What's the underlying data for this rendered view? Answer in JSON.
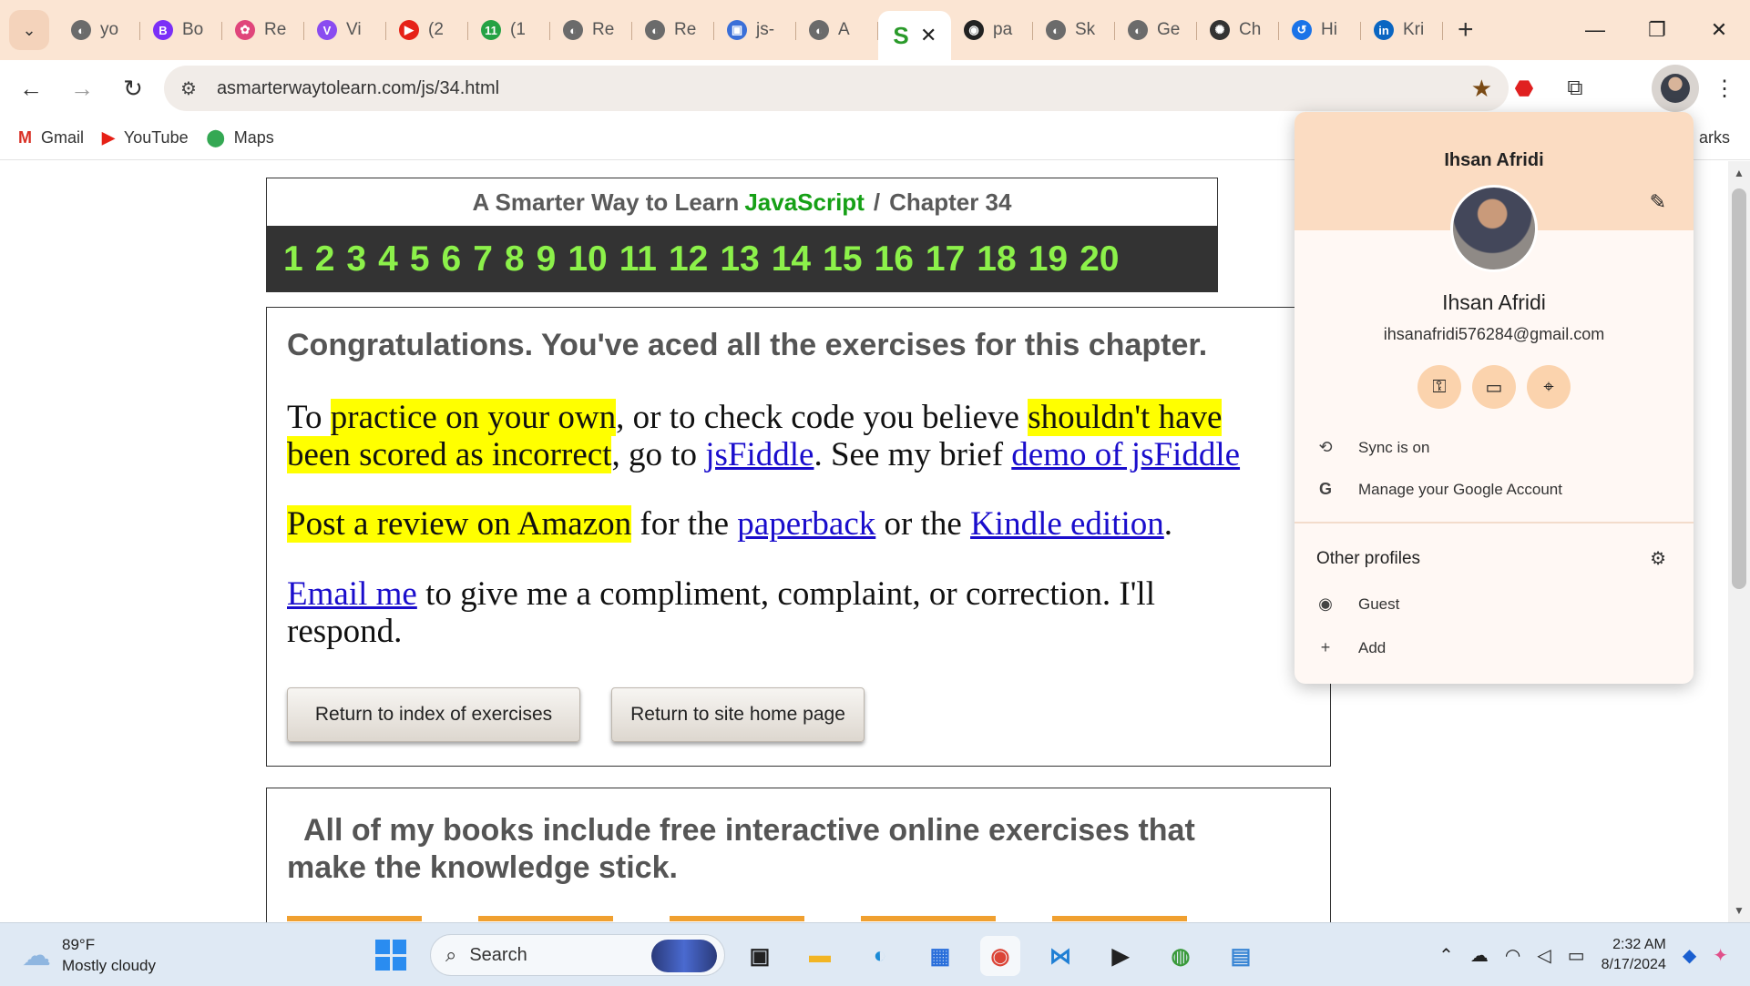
{
  "browser": {
    "tabs": [
      {
        "label": "yo",
        "fav": "◐",
        "color": "#6b6b6b"
      },
      {
        "label": "Bo",
        "fav": "B",
        "color": "#7b2ff7"
      },
      {
        "label": "Re",
        "fav": "✿",
        "color": "#e0457b"
      },
      {
        "label": "Vi",
        "fav": "V",
        "color": "#8a4cf0"
      },
      {
        "label": "(2",
        "fav": "▶",
        "color": "#e62117"
      },
      {
        "label": "(1",
        "fav": "11",
        "color": "#25a244"
      },
      {
        "label": "Re",
        "fav": "◐",
        "color": "#6b6b6b"
      },
      {
        "label": "Re",
        "fav": "◐",
        "color": "#6b6b6b"
      },
      {
        "label": "js-",
        "fav": "▣",
        "color": "#3a6fd8"
      },
      {
        "label": "A",
        "fav": "◐",
        "color": "#6b6b6b"
      }
    ],
    "active_tab": {
      "fav": "S",
      "close": "✕"
    },
    "tabs_after": [
      {
        "label": "pa",
        "fav": "◉",
        "color": "#222222"
      },
      {
        "label": "Sk",
        "fav": "◐",
        "color": "#6b6b6b"
      },
      {
        "label": "Ge",
        "fav": "◐",
        "color": "#6b6b6b"
      },
      {
        "label": "Ch",
        "fav": "✺",
        "color": "#333333"
      },
      {
        "label": "Hi",
        "fav": "↺",
        "color": "#1a73e8"
      },
      {
        "label": "Kri",
        "fav": "in",
        "color": "#0a66c2"
      }
    ],
    "new_tab": "+",
    "window_controls": {
      "minimize": "—",
      "restore": "❐",
      "close": "✕"
    },
    "url": "asmarterwaytolearn.com/js/34.html",
    "bookmarks": [
      {
        "label": "Gmail",
        "icon": "M",
        "color": "#d93025"
      },
      {
        "label": "YouTube",
        "icon": "▶",
        "color": "#e62117"
      },
      {
        "label": "Maps",
        "icon": "⬤",
        "color": "#34a853"
      }
    ],
    "bookmarks_right": "arks"
  },
  "page": {
    "header": {
      "prefix": "A Smarter Way to Learn",
      "brand": "JavaScript",
      "separator": "/",
      "chapter": "Chapter 34",
      "chapters": [
        "1",
        "2",
        "3",
        "4",
        "5",
        "6",
        "7",
        "8",
        "9",
        "10",
        "11",
        "12",
        "13",
        "14",
        "15",
        "16",
        "17",
        "18",
        "19",
        "20"
      ]
    },
    "congrats": "Congratulations. You've aced all the exercises for this chapter.",
    "p1": {
      "t1": "To ",
      "h1": "practice on your own",
      "t2": ", or to check code you believe ",
      "h2": "shouldn't have",
      "h3": "been scored as incorrect",
      "t3": ", go to ",
      "l1": "jsFiddle",
      "t4": ". See my brief ",
      "l2": "demo of jsFiddle"
    },
    "p2": {
      "h1": "Post a review on Amazon",
      "t1": " for the ",
      "l1": "paperback",
      "t2": " or the ",
      "l2": "Kindle edition",
      "t3": "."
    },
    "p3": {
      "l1": "Email me",
      "t1": " to give me a compliment, complaint, or correction. I'll",
      "t2": "respond."
    },
    "buttons": {
      "index": "Return to index of exercises",
      "home": "Return to site home page"
    },
    "books": {
      "line1": "All of my books include free interactive online exercises that",
      "line2": "make the knowledge stick."
    }
  },
  "profile": {
    "name_top": "Ihsan Afridi",
    "name": "Ihsan Afridi",
    "email": "ihsanafridi576284@gmail.com",
    "sync": "Sync is on",
    "manage": "Manage your Google Account",
    "other_profiles": "Other profiles",
    "guest": "Guest",
    "add": "Add"
  },
  "taskbar": {
    "temp": "89°F",
    "condition": "Mostly cloudy",
    "search": "Search",
    "time": "2:32 AM",
    "date": "8/17/2024"
  }
}
